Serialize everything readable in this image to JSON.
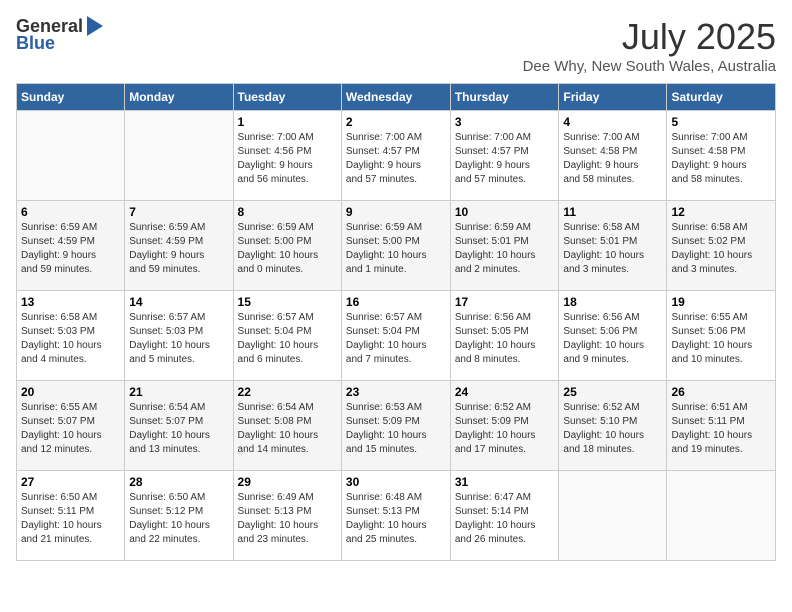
{
  "header": {
    "logo_general": "General",
    "logo_blue": "Blue",
    "title": "July 2025",
    "location": "Dee Why, New South Wales, Australia"
  },
  "weekdays": [
    "Sunday",
    "Monday",
    "Tuesday",
    "Wednesday",
    "Thursday",
    "Friday",
    "Saturday"
  ],
  "weeks": [
    [
      {
        "day": "",
        "info": ""
      },
      {
        "day": "",
        "info": ""
      },
      {
        "day": "1",
        "info": "Sunrise: 7:00 AM\nSunset: 4:56 PM\nDaylight: 9 hours\nand 56 minutes."
      },
      {
        "day": "2",
        "info": "Sunrise: 7:00 AM\nSunset: 4:57 PM\nDaylight: 9 hours\nand 57 minutes."
      },
      {
        "day": "3",
        "info": "Sunrise: 7:00 AM\nSunset: 4:57 PM\nDaylight: 9 hours\nand 57 minutes."
      },
      {
        "day": "4",
        "info": "Sunrise: 7:00 AM\nSunset: 4:58 PM\nDaylight: 9 hours\nand 58 minutes."
      },
      {
        "day": "5",
        "info": "Sunrise: 7:00 AM\nSunset: 4:58 PM\nDaylight: 9 hours\nand 58 minutes."
      }
    ],
    [
      {
        "day": "6",
        "info": "Sunrise: 6:59 AM\nSunset: 4:59 PM\nDaylight: 9 hours\nand 59 minutes."
      },
      {
        "day": "7",
        "info": "Sunrise: 6:59 AM\nSunset: 4:59 PM\nDaylight: 9 hours\nand 59 minutes."
      },
      {
        "day": "8",
        "info": "Sunrise: 6:59 AM\nSunset: 5:00 PM\nDaylight: 10 hours\nand 0 minutes."
      },
      {
        "day": "9",
        "info": "Sunrise: 6:59 AM\nSunset: 5:00 PM\nDaylight: 10 hours\nand 1 minute."
      },
      {
        "day": "10",
        "info": "Sunrise: 6:59 AM\nSunset: 5:01 PM\nDaylight: 10 hours\nand 2 minutes."
      },
      {
        "day": "11",
        "info": "Sunrise: 6:58 AM\nSunset: 5:01 PM\nDaylight: 10 hours\nand 3 minutes."
      },
      {
        "day": "12",
        "info": "Sunrise: 6:58 AM\nSunset: 5:02 PM\nDaylight: 10 hours\nand 3 minutes."
      }
    ],
    [
      {
        "day": "13",
        "info": "Sunrise: 6:58 AM\nSunset: 5:03 PM\nDaylight: 10 hours\nand 4 minutes."
      },
      {
        "day": "14",
        "info": "Sunrise: 6:57 AM\nSunset: 5:03 PM\nDaylight: 10 hours\nand 5 minutes."
      },
      {
        "day": "15",
        "info": "Sunrise: 6:57 AM\nSunset: 5:04 PM\nDaylight: 10 hours\nand 6 minutes."
      },
      {
        "day": "16",
        "info": "Sunrise: 6:57 AM\nSunset: 5:04 PM\nDaylight: 10 hours\nand 7 minutes."
      },
      {
        "day": "17",
        "info": "Sunrise: 6:56 AM\nSunset: 5:05 PM\nDaylight: 10 hours\nand 8 minutes."
      },
      {
        "day": "18",
        "info": "Sunrise: 6:56 AM\nSunset: 5:06 PM\nDaylight: 10 hours\nand 9 minutes."
      },
      {
        "day": "19",
        "info": "Sunrise: 6:55 AM\nSunset: 5:06 PM\nDaylight: 10 hours\nand 10 minutes."
      }
    ],
    [
      {
        "day": "20",
        "info": "Sunrise: 6:55 AM\nSunset: 5:07 PM\nDaylight: 10 hours\nand 12 minutes."
      },
      {
        "day": "21",
        "info": "Sunrise: 6:54 AM\nSunset: 5:07 PM\nDaylight: 10 hours\nand 13 minutes."
      },
      {
        "day": "22",
        "info": "Sunrise: 6:54 AM\nSunset: 5:08 PM\nDaylight: 10 hours\nand 14 minutes."
      },
      {
        "day": "23",
        "info": "Sunrise: 6:53 AM\nSunset: 5:09 PM\nDaylight: 10 hours\nand 15 minutes."
      },
      {
        "day": "24",
        "info": "Sunrise: 6:52 AM\nSunset: 5:09 PM\nDaylight: 10 hours\nand 17 minutes."
      },
      {
        "day": "25",
        "info": "Sunrise: 6:52 AM\nSunset: 5:10 PM\nDaylight: 10 hours\nand 18 minutes."
      },
      {
        "day": "26",
        "info": "Sunrise: 6:51 AM\nSunset: 5:11 PM\nDaylight: 10 hours\nand 19 minutes."
      }
    ],
    [
      {
        "day": "27",
        "info": "Sunrise: 6:50 AM\nSunset: 5:11 PM\nDaylight: 10 hours\nand 21 minutes."
      },
      {
        "day": "28",
        "info": "Sunrise: 6:50 AM\nSunset: 5:12 PM\nDaylight: 10 hours\nand 22 minutes."
      },
      {
        "day": "29",
        "info": "Sunrise: 6:49 AM\nSunset: 5:13 PM\nDaylight: 10 hours\nand 23 minutes."
      },
      {
        "day": "30",
        "info": "Sunrise: 6:48 AM\nSunset: 5:13 PM\nDaylight: 10 hours\nand 25 minutes."
      },
      {
        "day": "31",
        "info": "Sunrise: 6:47 AM\nSunset: 5:14 PM\nDaylight: 10 hours\nand 26 minutes."
      },
      {
        "day": "",
        "info": ""
      },
      {
        "day": "",
        "info": ""
      }
    ]
  ]
}
